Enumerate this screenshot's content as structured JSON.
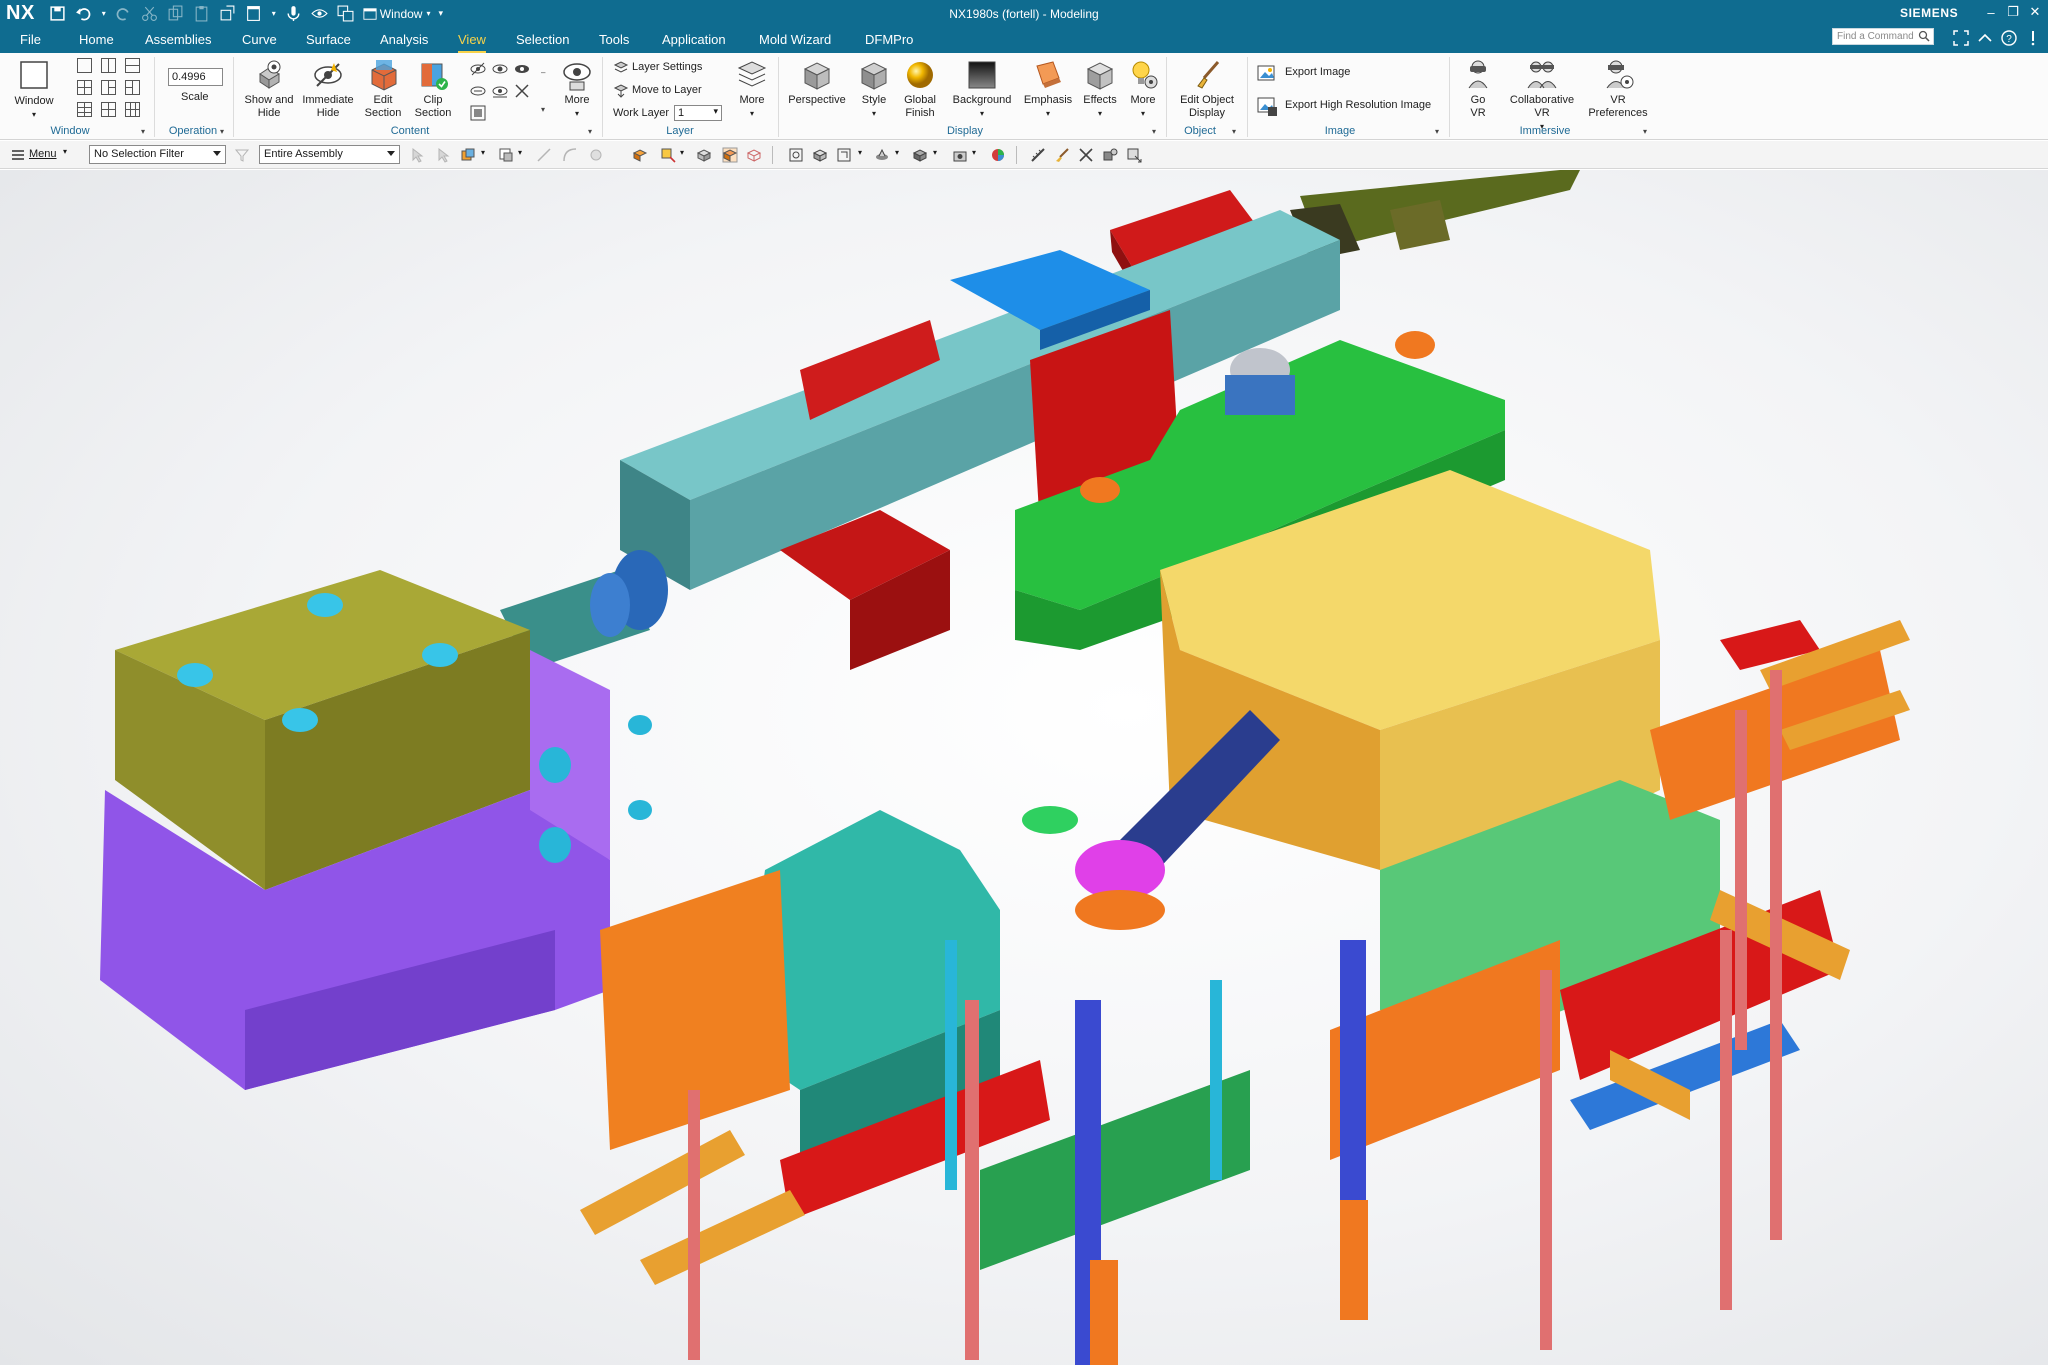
{
  "app": {
    "logo": "NX",
    "title": "NX1980s (fortell) - Modeling",
    "brand": "SIEMENS",
    "window_menu": "Window"
  },
  "tabs": [
    {
      "label": "File"
    },
    {
      "label": "Home"
    },
    {
      "label": "Assemblies"
    },
    {
      "label": "Curve"
    },
    {
      "label": "Surface"
    },
    {
      "label": "Analysis"
    },
    {
      "label": "View",
      "active": true
    },
    {
      "label": "Selection"
    },
    {
      "label": "Tools"
    },
    {
      "label": "Application"
    },
    {
      "label": "Mold Wizard"
    },
    {
      "label": "DFMPro"
    }
  ],
  "search": {
    "placeholder": "Find a Command"
  },
  "ribbon": {
    "window": {
      "button": "Window",
      "group": "Window"
    },
    "operation": {
      "scale_value": "0.4996",
      "scale_label": "Scale",
      "group": "Operation"
    },
    "content": {
      "show_hide": "Show and Hide",
      "immediate_hide": "Immediate Hide",
      "edit_section": "Edit Section",
      "clip_section": "Clip Section",
      "more": "More",
      "group": "Content"
    },
    "layer": {
      "layer_settings": "Layer Settings",
      "move_to_layer": "Move to Layer",
      "work_layer_label": "Work Layer",
      "work_layer_value": "1",
      "more": "More",
      "group": "Layer"
    },
    "display": {
      "perspective": "Perspective",
      "style": "Style",
      "global_finish": "Global Finish",
      "background": "Background",
      "emphasis": "Emphasis",
      "effects": "Effects",
      "more": "More",
      "group": "Display"
    },
    "object": {
      "edit_object_display": "Edit Object Display",
      "group": "Object"
    },
    "image": {
      "export_image": "Export Image",
      "export_high_res": "Export High Resolution Image",
      "group": "Image"
    },
    "immersive": {
      "go_vr": "Go VR",
      "collab_vr": "Collaborative VR",
      "vr_prefs": "VR Preferences",
      "group": "Immersive"
    }
  },
  "selection_bar": {
    "menu": "Menu",
    "selection_filter": "No Selection Filter",
    "scope": "Entire Assembly"
  },
  "colors": {
    "titlebar": "#0f6c90",
    "active_tab": "#f7d24a",
    "group_label": "#1f6a95"
  }
}
